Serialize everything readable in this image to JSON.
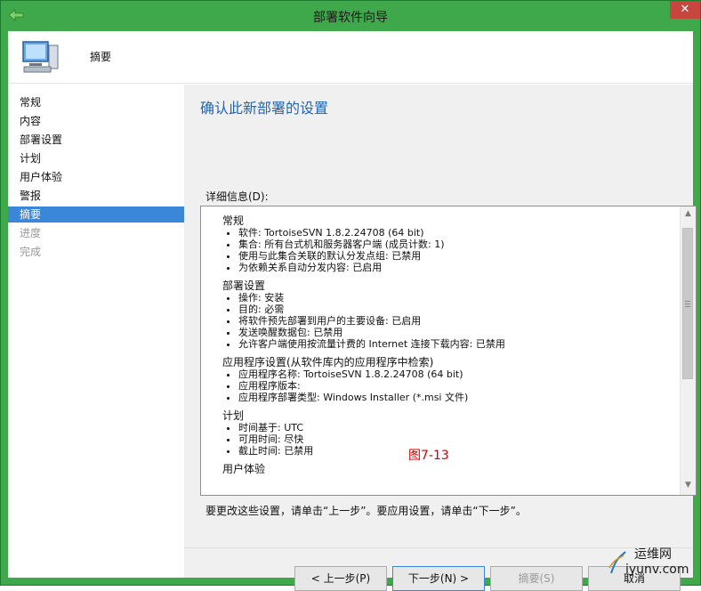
{
  "window": {
    "title": "部署软件向导",
    "close_glyph": "✕"
  },
  "header": {
    "title": "摘要"
  },
  "nav": {
    "items": [
      {
        "label": "常规",
        "state": "normal"
      },
      {
        "label": "内容",
        "state": "normal"
      },
      {
        "label": "部署设置",
        "state": "normal"
      },
      {
        "label": "计划",
        "state": "normal"
      },
      {
        "label": "用户体验",
        "state": "normal"
      },
      {
        "label": "警报",
        "state": "normal"
      },
      {
        "label": "摘要",
        "state": "active"
      },
      {
        "label": "进度",
        "state": "disabled"
      },
      {
        "label": "完成",
        "state": "disabled"
      }
    ]
  },
  "main": {
    "heading": "确认此新部署的设置",
    "details_label": "详细信息(D):",
    "sections": [
      {
        "title": "常规",
        "items": [
          "软件: TortoiseSVN 1.8.2.24708 (64 bit)",
          "集合: 所有台式机和服务器客户端 (成员计数: 1)",
          "使用与此集合关联的默认分发点组: 已禁用",
          "为依赖关系自动分发内容: 已启用"
        ]
      },
      {
        "title": "部署设置",
        "items": [
          "操作: 安装",
          "目的: 必需",
          "将软件预先部署到用户的主要设备: 已启用",
          "发送唤醒数据包: 已禁用",
          "允许客户端使用按流量计费的 Internet 连接下载内容: 已禁用"
        ]
      },
      {
        "title": "应用程序设置(从软件库内的应用程序中检索)",
        "items": [
          "应用程序名称: TortoiseSVN 1.8.2.24708 (64 bit)",
          "应用程序版本:",
          "应用程序部署类型: Windows Installer (*.msi 文件)"
        ]
      },
      {
        "title": "计划",
        "items": [
          "时间基于: UTC",
          "可用时间: 尽快",
          "截止时间: 已禁用"
        ]
      },
      {
        "title": "用户体验",
        "items": []
      }
    ],
    "figure_label": "图7-13",
    "hint": "要更改这些设置，请单击“上一步”。要应用设置，请单击“下一步”。"
  },
  "buttons": {
    "prev": "< 上一步(P)",
    "next": "下一步(N) >",
    "summary": "摘要(S)",
    "cancel": "取消"
  },
  "watermark": {
    "line1": "运维网",
    "line2": "iyunv.com"
  },
  "colors": {
    "title_bar": "#3fa84a",
    "accent": "#3a86d8",
    "heading": "#1f66b5",
    "figure_label": "#d00000"
  }
}
